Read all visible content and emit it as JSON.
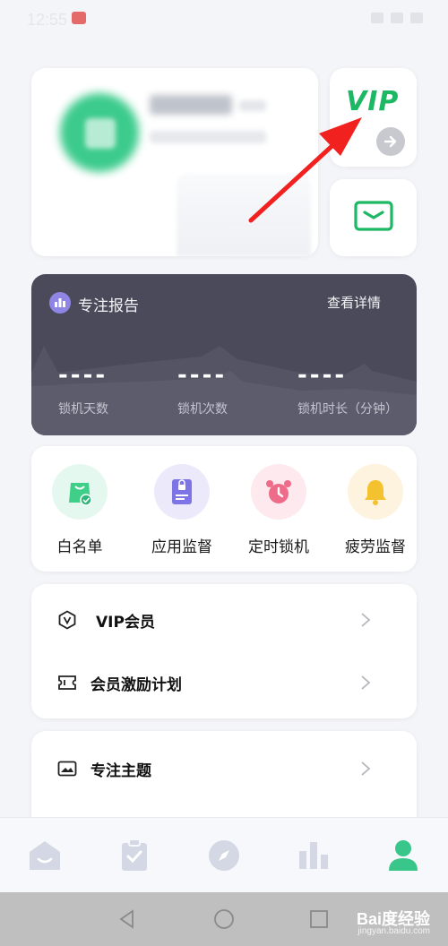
{
  "status_bar": {
    "time": "12:55"
  },
  "profile": {
    "name_hidden": true
  },
  "vip_card": {
    "label": "VIP"
  },
  "focus_report": {
    "title": "专注报告",
    "details_link": "查看详情",
    "stats": [
      {
        "value": "----",
        "label": "锁机天数"
      },
      {
        "value": "----",
        "label": "锁机次数"
      },
      {
        "value": "----",
        "label": "锁机时长（分钟）"
      }
    ]
  },
  "tools": [
    {
      "label": "白名单",
      "icon": "whitelist-bag-icon",
      "bg": "#e5f8ef"
    },
    {
      "label": "应用监督",
      "icon": "app-monitor-icon",
      "bg": "#ece9fb"
    },
    {
      "label": "定时锁机",
      "icon": "alarm-clock-icon",
      "bg": "#fde9ee"
    },
    {
      "label": "疲劳监督",
      "icon": "bell-icon",
      "bg": "#fdf3df"
    }
  ],
  "menu": {
    "vip_member": "VIP会员",
    "incentive_plan": "会员激励计划",
    "focus_theme": "专注主题"
  },
  "bottom_nav": [
    "home-icon",
    "tasks-clipboard-icon",
    "discover-compass-icon",
    "stats-chart-icon",
    "profile-user-icon"
  ],
  "watermark": {
    "brand": "Bai度经验",
    "url": "jingyan.baidu.com"
  },
  "colors": {
    "accent_green": "#1cb864",
    "focus_card_bg": "#4a4a5a",
    "page_bg": "#f4f5f9"
  }
}
